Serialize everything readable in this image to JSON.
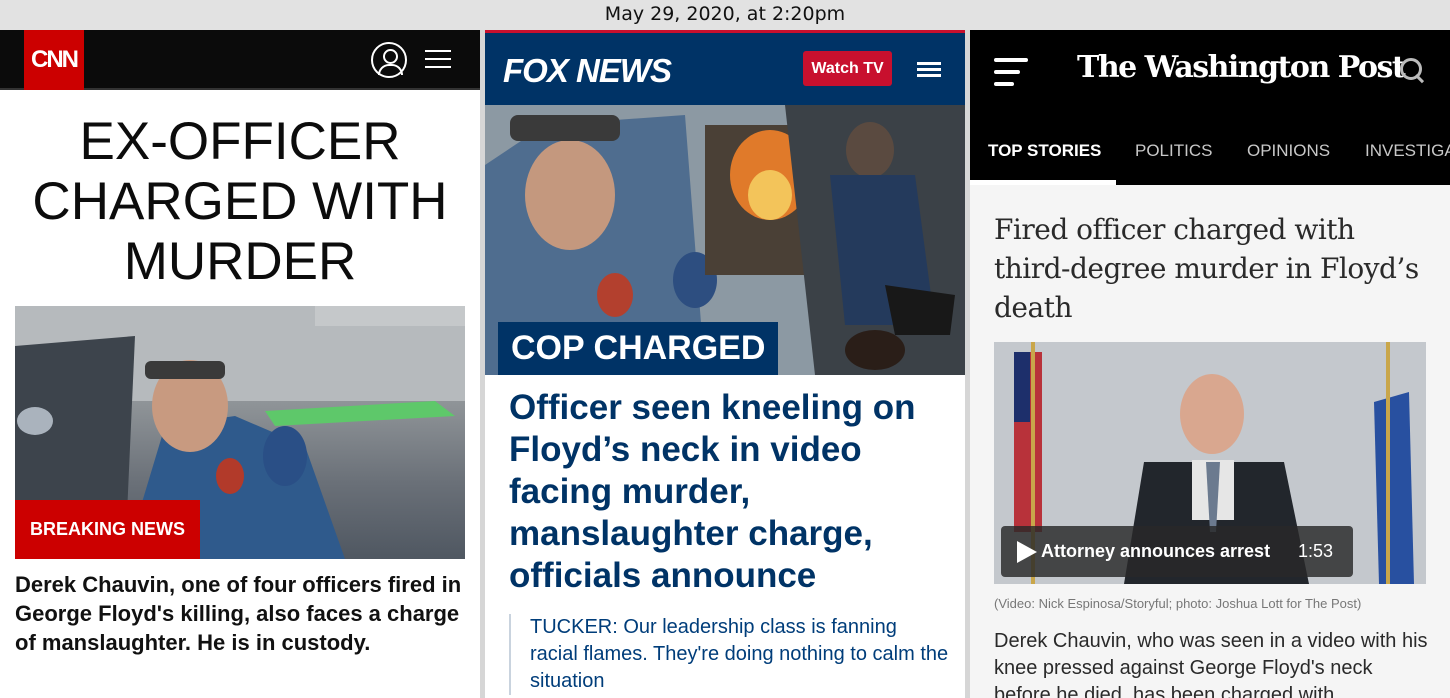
{
  "timestamp": "May 29, 2020, at 2:20pm",
  "cnn": {
    "logo": "CNN",
    "headline": "EX-OFFICER CHARGED WITH MURDER",
    "badge": "BREAKING NEWS",
    "summary": "Derek Chauvin, one of four officers fired in George Floyd's killing, also faces a charge of manslaughter. He is in custody.",
    "icons": [
      "user-icon",
      "menu-icon"
    ],
    "colors": {
      "brand": "#cc0000",
      "bar": "#0b0b0b"
    }
  },
  "fox": {
    "logo": "FOX NEWS",
    "watch_label": "Watch TV",
    "tag": "COP CHARGED",
    "headline": "Officer seen kneeling on Floyd’s neck in video facing murder, manslaughter charge, officials announce",
    "sub": "TUCKER: Our leadership class is fanning racial flames. They're doing nothing to calm the situation",
    "icons": [
      "menu-icon"
    ],
    "colors": {
      "brand": "#003366",
      "accent": "#c8102e"
    }
  },
  "wapo": {
    "logo": "The Washington Post",
    "tabs": [
      "TOP STORIES",
      "POLITICS",
      "OPINIONS",
      "INVESTIGA"
    ],
    "active_tab": "TOP STORIES",
    "headline": "Fired officer charged with third-degree murder in Floyd’s death",
    "video_title": "Attorney announces arrest",
    "video_duration": "1:53",
    "credit": "(Video: Nick Espinosa/Storyful; photo: Joshua Lott for The Post)",
    "summary": "Derek Chauvin, who was seen in a video with his knee pressed against George Floyd's neck before he died, has been charged with",
    "icons": [
      "menu-icon",
      "search-icon",
      "play-icon"
    ],
    "colors": {
      "bar": "#000000",
      "background": "#f5f5f5"
    }
  }
}
